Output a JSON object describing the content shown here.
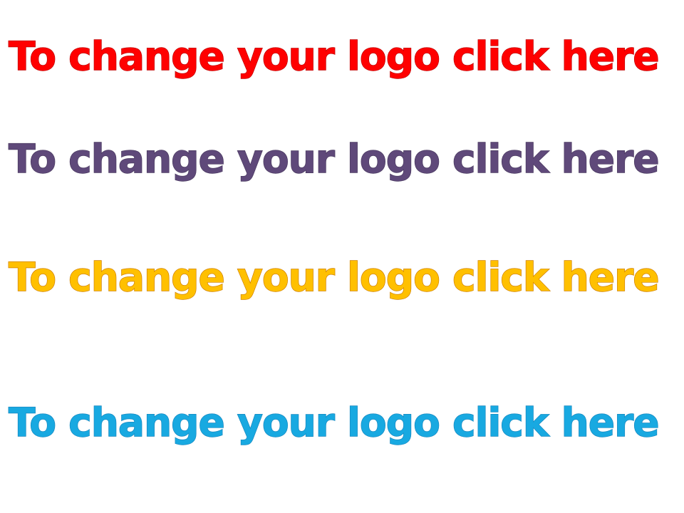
{
  "lines": [
    {
      "text": "To change your logo click here",
      "fill": "#ff0000",
      "stroke": "#c00000"
    },
    {
      "text": "To change your logo click here",
      "fill": "#5f497a",
      "stroke": "#4a3a60"
    },
    {
      "text": "To change your logo click here",
      "fill": "#ffc000",
      "stroke": "#d08000"
    },
    {
      "text": "To change your logo click here",
      "fill": "#18a9e1",
      "stroke": "#1788c0"
    }
  ]
}
